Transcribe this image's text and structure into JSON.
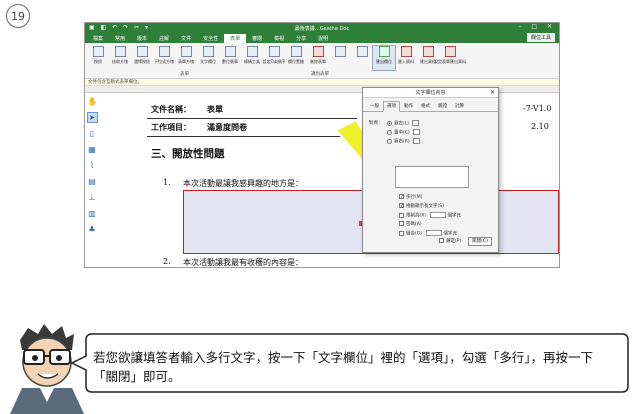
{
  "step_number": "19",
  "window": {
    "title": "最後表議…Gaatha Doc",
    "tabs": [
      "檔案",
      "常用",
      "版本",
      "註解",
      "文件",
      "安全性",
      "表單",
      "審閱",
      "檢視",
      "分享",
      "說明"
    ],
    "active_tab": "表單",
    "context_tab": "欄位工具"
  },
  "ribbon": {
    "buttons": [
      "按鈕",
      "核取方塊",
      "選擇按鈕",
      "下拉式方塊",
      "清單方塊",
      "文字欄位",
      "數位簽章",
      "條碼工具",
      "設定Tab順序",
      "欄位置檢",
      "刪除表單",
      "",
      "",
      "匯出欄位",
      "匯入資料",
      "匯出資料",
      "設定表單匯出資料"
    ],
    "highlighted": "文字欄位",
    "group_labels": [
      "表單",
      "識別表單"
    ]
  },
  "notification": "文件包含互動式表單欄位。",
  "document": {
    "field_name_label": "文件名稱：",
    "field_name_value": "表單",
    "work_item_label": "工作項目：",
    "work_item_value": "滿意度問卷",
    "right_top": "-7-V1.0",
    "right_bottom": "2.10",
    "section_heading": "三、開放性問題",
    "q1_num": "1.",
    "q1_text": "本次活動最讓我感興趣的地方是：",
    "q2_num": "2.",
    "q2_text": "本次活動讓我最有收穫的內容是："
  },
  "dialog": {
    "title": "文字欄位內容",
    "close_x": "✕",
    "tabs": [
      "一般",
      "選項",
      "動作",
      "格式",
      "驗證",
      "計算"
    ],
    "active_tab": "選項",
    "align_label": "對齊：",
    "align_options": [
      "靠左(L)",
      "置中(C)",
      "靠右(R)"
    ],
    "multiline_label": "多行(M)",
    "multiline_checked": true,
    "scroll_label": "捲動顯示長文字(S)",
    "scroll_checked": true,
    "limit_label": "限制為(X)",
    "limit_unit": "個字元",
    "password_label": "密碼(A)",
    "comb_label": "組合(O)",
    "comb_unit": "個字元",
    "locked_label": "鎖定(P)",
    "close_button": "關閉(C)"
  },
  "caption": "若您欲讓填答者輸入多行文字，按一下「文字欄位」裡的「選項」，勾選「多行」，再按一下「關閉」即可。",
  "colors": {
    "ribbon_green": "#2f7f39",
    "answer_fill": "#e3e3f2",
    "answer_border": "#c02020",
    "arrow_yellow": "#f0ef2a"
  }
}
